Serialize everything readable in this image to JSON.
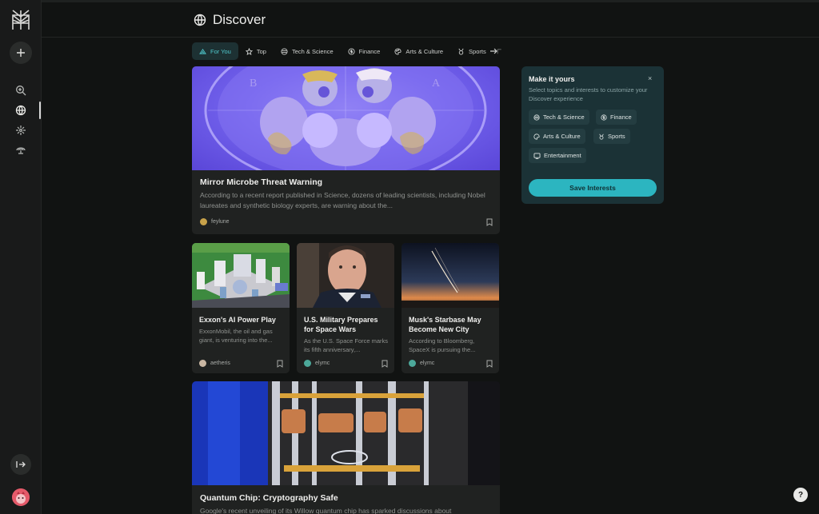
{
  "app": {
    "page_title": "Discover"
  },
  "icons": {
    "logo": "perplexity-logo-icon",
    "new": "plus-icon",
    "search": "search-icon",
    "discover": "globe-icon",
    "spaces": "sparkle-icon",
    "library": "library-icon",
    "collapse": "expand-sidebar-icon",
    "title": "globe-icon",
    "help": "help-icon"
  },
  "tabs": [
    {
      "label": "For You",
      "icon": "for-you-icon",
      "active": true
    },
    {
      "label": "Top",
      "icon": "star-icon"
    },
    {
      "label": "Tech & Science",
      "icon": "cpu-icon"
    },
    {
      "label": "Finance",
      "icon": "dollar-icon"
    },
    {
      "label": "Arts & Culture",
      "icon": "palette-icon"
    },
    {
      "label": "Sports",
      "icon": "medal-icon"
    }
  ],
  "feed": {
    "hero": {
      "title": "Mirror Microbe Threat Warning",
      "description": "According to a recent report published in Science, dozens of leading scientists, including Nobel laureates and synthetic biology experts, are warning about the...",
      "author": "feylune"
    },
    "cards": [
      {
        "title": "Exxon's AI Power Play",
        "description": "ExxonMobil, the oil and gas giant, is venturing into the...",
        "author": "aetheris"
      },
      {
        "title": "U.S. Military Prepares for Space Wars",
        "description": "As the U.S. Space Force marks its fifth anniversary,...",
        "author": "elymc"
      },
      {
        "title": "Musk's Starbase May Become New City",
        "description": "According to Bloomberg, SpaceX is pursuing the...",
        "author": "elymc"
      }
    ],
    "second": {
      "title": "Quantum Chip: Cryptography Safe",
      "description": "Google's recent unveiling of its Willow quantum chip has sparked discussions about"
    }
  },
  "interests_panel": {
    "title": "Make it yours",
    "close": "×",
    "subtitle": "Select topics and interests to customize your Discover experience",
    "chips": [
      {
        "label": "Tech & Science",
        "icon": "cpu-icon"
      },
      {
        "label": "Finance",
        "icon": "dollar-icon"
      },
      {
        "label": "Arts & Culture",
        "icon": "palette-icon"
      },
      {
        "label": "Sports",
        "icon": "medal-icon"
      },
      {
        "label": "Entertainment",
        "icon": "tv-icon"
      }
    ],
    "save_label": "Save Interests"
  },
  "help_label": "?",
  "colors": {
    "accent": "#2cb5c0",
    "background": "#111312",
    "panel": "#1b3236"
  }
}
